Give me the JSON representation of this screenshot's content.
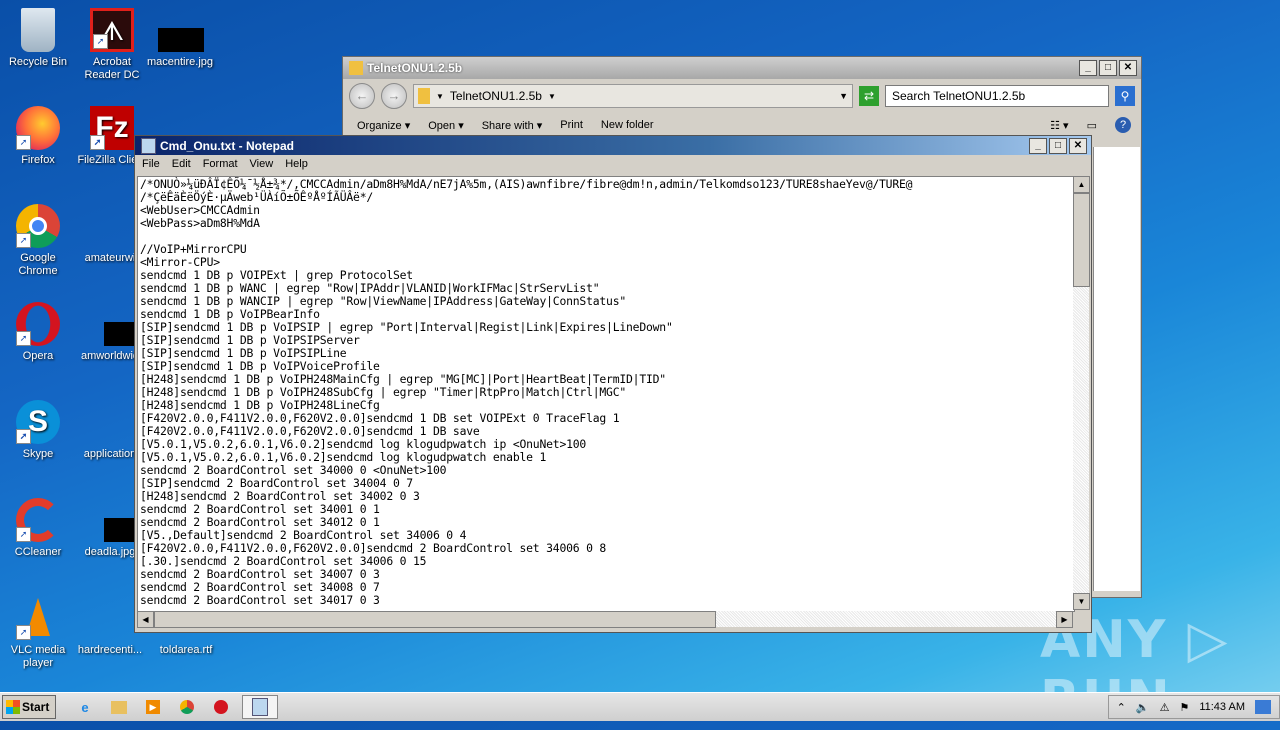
{
  "desktop": {
    "icons": [
      {
        "label": "Recycle Bin",
        "icon": "recycle-bin-icon"
      },
      {
        "label": "Acrobat Reader DC",
        "icon": "acrobat-icon"
      },
      {
        "label": "macentire.jpg",
        "icon": "image-file-icon"
      },
      {
        "label": "Firefox",
        "icon": "firefox-icon"
      },
      {
        "label": "FileZilla Client",
        "icon": "filezilla-icon"
      },
      {
        "label": "Google Chrome",
        "icon": "chrome-icon"
      },
      {
        "label": "amateurwi",
        "icon": "file-icon"
      },
      {
        "label": "Opera",
        "icon": "opera-icon"
      },
      {
        "label": "amworldwid",
        "icon": "file-icon"
      },
      {
        "label": "Skype",
        "icon": "skype-icon"
      },
      {
        "label": "application",
        "icon": "file-icon"
      },
      {
        "label": "CCleaner",
        "icon": "ccleaner-icon"
      },
      {
        "label": "deadla.jpg",
        "icon": "image-file-icon"
      },
      {
        "label": "VLC media player",
        "icon": "vlc-icon"
      },
      {
        "label": "hardrecenti...",
        "icon": "file-icon"
      },
      {
        "label": "toldarea.rtf",
        "icon": "rtf-file-icon"
      }
    ]
  },
  "explorer": {
    "title": "TelnetONU1.2.5b",
    "address": "TelnetONU1.2.5b",
    "search_placeholder": "Search TelnetONU1.2.5b",
    "toolbar": [
      "Organize",
      "Open",
      "Share with",
      "Print",
      "New folder"
    ]
  },
  "notepad": {
    "title": "Cmd_Onu.txt - Notepad",
    "menu": [
      "File",
      "Edit",
      "Format",
      "View",
      "Help"
    ],
    "content": "/*ONUÒ»¼üÐÂÏ¢ÊÕ¼¯½Å±¾*/,CMCCAdmin/aDm8H%MdA/nE7jA%5m,(AIS)awnfibre/fibre@dm!n,admin/Telkomdso123/TURE8shaeYev@/TURE@\n/*ÇëÊäÈëÖýÈ·µÄweb¹ÜÀíÕ±ÕÊºÅºÍÃÜÂë*/\n<WebUser>CMCCAdmin\n<WebPass>aDm8H%MdA\n\n//VoIP+MirrorCPU\n<Mirror-CPU>\nsendcmd 1 DB p VOIPExt | grep ProtocolSet\nsendcmd 1 DB p WANC | egrep \"Row|IPAddr|VLANID|WorkIFMac|StrServList\"\nsendcmd 1 DB p WANCIP | egrep \"Row|ViewName|IPAddress|GateWay|ConnStatus\"\nsendcmd 1 DB p VoIPBearInfo\n[SIP]sendcmd 1 DB p VoIPSIP | egrep \"Port|Interval|Regist|Link|Expires|LineDown\"\n[SIP]sendcmd 1 DB p VoIPSIPServer\n[SIP]sendcmd 1 DB p VoIPSIPLine\n[SIP]sendcmd 1 DB p VoIPVoiceProfile\n[H248]sendcmd 1 DB p VoIPH248MainCfg | egrep \"MG[MC]|Port|HeartBeat|TermID|TID\"\n[H248]sendcmd 1 DB p VoIPH248SubCfg | egrep \"Timer|RtpPro|Match|Ctrl|MGC\"\n[H248]sendcmd 1 DB p VoIPH248LineCfg\n[F420V2.0.0,F411V2.0.0,F620V2.0.0]sendcmd 1 DB set VOIPExt 0 TraceFlag 1\n[F420V2.0.0,F411V2.0.0,F620V2.0.0]sendcmd 1 DB save\n[V5.0.1,V5.0.2,6.0.1,V6.0.2]sendcmd log klogudpwatch ip <OnuNet>100\n[V5.0.1,V5.0.2,6.0.1,V6.0.2]sendcmd log klogudpwatch enable 1\nsendcmd 2 BoardControl set 34000 0 <OnuNet>100\n[SIP]sendcmd 2 BoardControl set 34004 0 7\n[H248]sendcmd 2 BoardControl set 34002 0 3\nsendcmd 2 BoardControl set 34001 0 1\nsendcmd 2 BoardControl set 34012 0 1\n[V5.,Default]sendcmd 2 BoardControl set 34006 0 4\n[F420V2.0.0,F411V2.0.0,F620V2.0.0]sendcmd 2 BoardControl set 34006 0 8\n[.30.]sendcmd 2 BoardControl set 34006 0 15\nsendcmd 2 BoardControl set 34007 0 3\nsendcmd 2 BoardControl set 34008 0 7\nsendcmd 2 BoardControl set 34017 0 3"
  },
  "taskbar": {
    "start_label": "Start",
    "apps": [
      "internet-explorer-icon",
      "file-explorer-icon",
      "media-player-icon",
      "chrome-icon",
      "opera-icon",
      "notepad-icon"
    ],
    "clock": "11:43 AM"
  },
  "watermark": "ANY ▷ RUN"
}
